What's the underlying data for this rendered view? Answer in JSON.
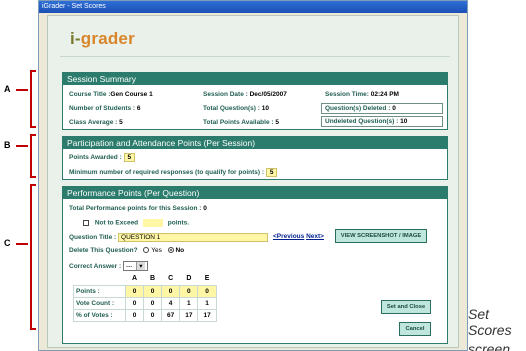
{
  "window": {
    "title": "iGrader - Set Scores"
  },
  "logo": {
    "prefix": "i-",
    "name": "grader"
  },
  "session": {
    "heading": "Session Summary",
    "course_title_label": "Course Title :",
    "course_title": "Gen Course 1",
    "session_date_label": "Session Date :",
    "session_date": "Dec/05/2007",
    "session_time_label": "Session Time:",
    "session_time": "02:24 PM",
    "num_students_label": "Number of Students :",
    "num_students": "6",
    "total_questions_label": "Total Question(s) :",
    "total_questions": "10",
    "questions_deleted_label": "Question(s) Deleted :",
    "questions_deleted": "0",
    "class_average_label": "Class Average :",
    "class_average": "5",
    "total_points_label": "Total Points Available :",
    "total_points": "5",
    "undeleted_label": "Undeleted Question(s) :",
    "undeleted": "10"
  },
  "participation": {
    "heading": "Participation and Attendance Points (Per Session)",
    "points_awarded_label": "Points Awarded :",
    "points_awarded": "5",
    "min_responses_label": "Minimum number of required responses (to qualify for points) :",
    "min_responses": "5"
  },
  "performance": {
    "heading": "Performance Points (Per Question)",
    "total_label": "Total Performance points for this Session :",
    "total_value": "0",
    "not_exceed_label": "Not to Exceed",
    "points_suffix": "points.",
    "question_title_label": "Question Title :",
    "question_title_value": "QUESTION 1",
    "previous_link": "<Previous",
    "next_link": "Next>",
    "view_button": "VIEW SCREENSHOT / IMAGE",
    "delete_label": "Delete This Question?",
    "yes_label": "Yes",
    "no_label": "No",
    "correct_answer_label": "Correct Answer :",
    "correct_answer_value": "---",
    "grid": {
      "columns": [
        "A",
        "B",
        "C",
        "D",
        "E"
      ],
      "rows": [
        {
          "label": "Points :",
          "values": [
            "0",
            "0",
            "0",
            "0",
            "0"
          ]
        },
        {
          "label": "Vote Count :",
          "values": [
            "0",
            "0",
            "4",
            "1",
            "1"
          ]
        },
        {
          "label": "% of Votes :",
          "values": [
            "0",
            "0",
            "67",
            "17",
            "17"
          ]
        }
      ]
    },
    "set_close_button": "Set and Close",
    "cancel_button": "Cancel"
  },
  "annotations": {
    "a": "A",
    "b": "B",
    "c": "C"
  },
  "caption": {
    "line1": "Set Scores",
    "line2": "screen"
  },
  "colors": {
    "accent": "#2b7c6c",
    "highlight": "#fff7a6",
    "annotation": "#c00000"
  }
}
